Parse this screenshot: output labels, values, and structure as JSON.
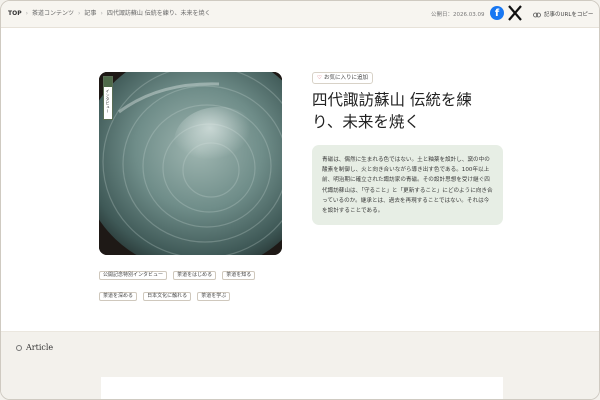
{
  "breadcrumb": {
    "items": [
      "TOP",
      "茶道コンテンツ",
      "記事",
      "四代諏訪蘇山 伝統を練り、未来を焼く"
    ]
  },
  "header": {
    "published": "公開日：2026.03.09",
    "facebook_glyph": "f",
    "copy_label": "記事のURLをコピー",
    "icons": [
      "facebook-icon",
      "x-icon",
      "link-icon"
    ]
  },
  "hero": {
    "badge_text": "インタビュー"
  },
  "tags": [
    "公開記念特別インタビュー",
    "茶道をはじめる",
    "茶道を知る",
    "茶道を深める",
    "日本文化に触れる",
    "茶道を学ぶ"
  ],
  "favorite": {
    "label": "お気に入りに追加"
  },
  "article": {
    "title": "四代諏訪蘇山 伝統を練り、未来を焼く",
    "summary": "青磁は、偶然に生まれる色ではない。土と釉薬を設計し、窯の中の酸素を制御し、火と向き合いながら導き出す色である。100年以上前、明治期に確立された諏訪家の青磁。その設計思想を受け継ぐ四代諏訪蘇山は、「守ること」と「更新すること」にどのように向き合っているのか。継承とは、過去を再現することではない。それは今を設計することである。",
    "section_label": "Article"
  },
  "colors": {
    "accent_green": "#4f6a4a",
    "summary_bg": "#e7eee5",
    "facebook": "#1877f2",
    "heart": "#d04a57"
  }
}
